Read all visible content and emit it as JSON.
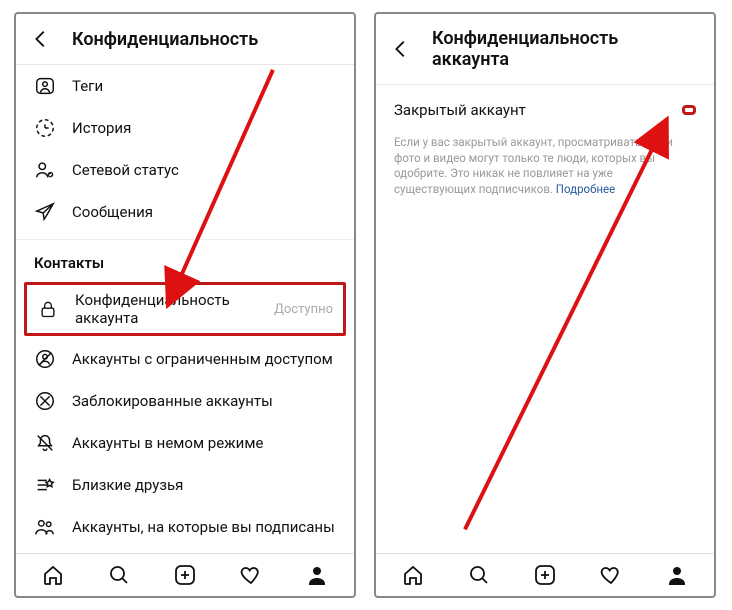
{
  "left": {
    "title": "Конфиденциальность",
    "items_top": [
      {
        "icon": "tag-user-icon",
        "label": "Теги"
      },
      {
        "icon": "history-icon",
        "label": "История"
      },
      {
        "icon": "status-icon",
        "label": "Сетевой статус"
      },
      {
        "icon": "messages-icon",
        "label": "Сообщения"
      }
    ],
    "section_label": "Контакты",
    "highlighted": {
      "icon": "lock-icon",
      "label": "Конфиденциальность аккаунта",
      "trailing": "Доступно"
    },
    "items_bottom": [
      {
        "icon": "restricted-icon",
        "label": "Аккаунты с ограниченным доступом"
      },
      {
        "icon": "blocked-icon",
        "label": "Заблокированные аккаунты"
      },
      {
        "icon": "muted-icon",
        "label": "Аккаунты в немом режиме"
      },
      {
        "icon": "close-friends-icon",
        "label": "Близкие друзья"
      },
      {
        "icon": "following-icon",
        "label": "Аккаунты, на которые вы подписаны"
      }
    ]
  },
  "right": {
    "title": "Конфиденциальность аккаунта",
    "toggle_label": "Закрытый аккаунт",
    "toggle_on": true,
    "desc_text": "Если у вас закрытый аккаунт, просматривать ваши фото и видео могут только те люди, которых вы одобрите. Это никак не повлияет на уже существующих подписчиков.",
    "desc_link": "Подробнее"
  },
  "nav": {
    "home": "home-icon",
    "search": "search-icon",
    "add": "add-post-icon",
    "activity": "heart-icon",
    "profile": "profile-icon"
  }
}
